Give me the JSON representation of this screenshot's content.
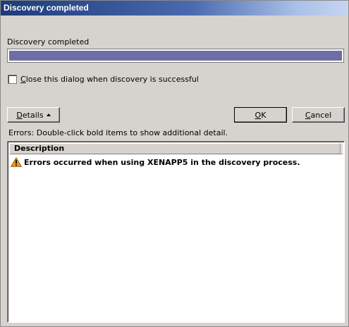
{
  "window": {
    "title": "Discovery completed"
  },
  "status": {
    "label": "Discovery completed",
    "progress_percent": 100,
    "progress_color": "#6e6ea6"
  },
  "checkbox": {
    "label_prefix": "C",
    "label_rest": "lose this dialog when discovery is successful",
    "checked": false
  },
  "buttons": {
    "details_mnemonic": "D",
    "details_rest": "etails",
    "ok_mnemonic": "O",
    "ok_rest": "K",
    "cancel_mnemonic": "C",
    "cancel_rest": "ancel"
  },
  "errors_hint": "Errors: Double-click bold items to show additional detail.",
  "list": {
    "columns": [
      "Description"
    ],
    "rows": [
      {
        "icon": "warning-icon",
        "text": "Errors occurred when using XENAPP5 in the discovery process."
      }
    ]
  },
  "colors": {
    "title_gradient_start": "#1d3b78",
    "title_gradient_end": "#c6d5f0",
    "dialog_bg": "#d6d3ce",
    "warning": "#e0a020"
  }
}
